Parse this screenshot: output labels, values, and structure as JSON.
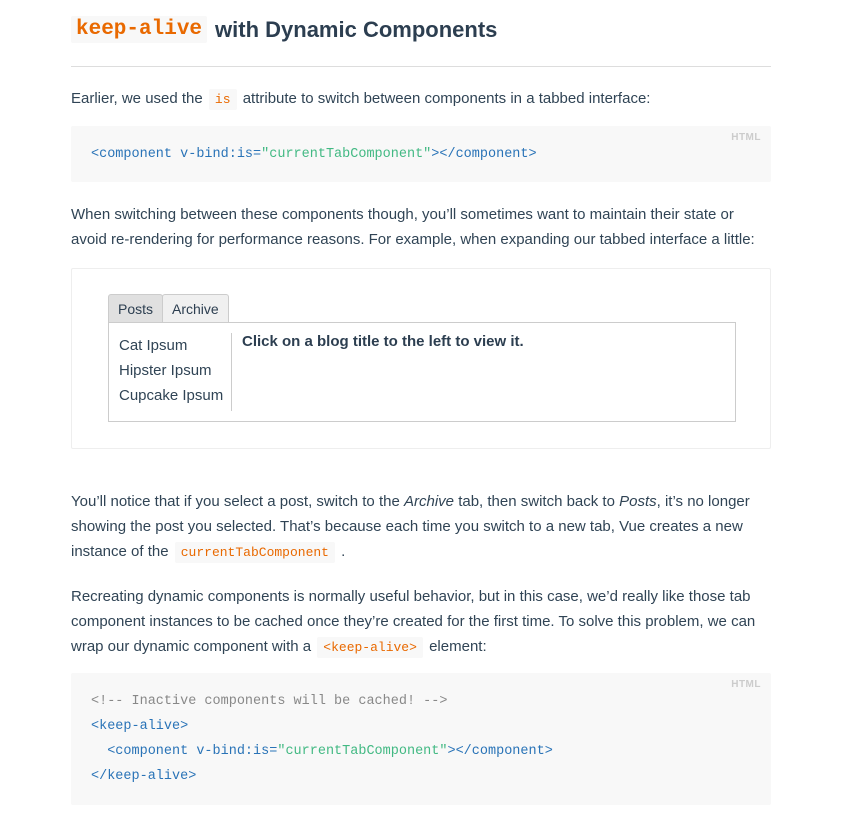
{
  "header": {
    "title_code": "keep-alive",
    "title_rest": "with Dynamic Components"
  },
  "intro": {
    "before": "Earlier, we used the",
    "code": "is",
    "after": "attribute to switch between components in a tabbed interface:"
  },
  "code1": {
    "lang": "HTML",
    "tag_open": "<component",
    "attr": " v-bind:is=",
    "value": "\"currentTabComponent\"",
    "tag_close": "></component>"
  },
  "para2": {
    "line1": "When switching between these components though, you’ll sometimes want to maintain their state or",
    "line2": "avoid re-rendering for performance reasons. For example, when expanding our tabbed interface a little:"
  },
  "demo": {
    "tabs": [
      {
        "label": "Posts",
        "active": true
      },
      {
        "label": "Archive",
        "active": false
      }
    ],
    "posts": [
      "Cat Ipsum",
      "Hipster Ipsum",
      "Cupcake Ipsum"
    ],
    "message": "Click on a blog title to the left to view it."
  },
  "para3": {
    "l1_a": "You’ll notice that if you select a post, switch to the",
    "l1_b": "Archive",
    "l1_c": "tab, then switch back to",
    "l1_d": "Posts",
    "l1_e": ", it’s no longer",
    "line2": "showing the post you selected. That’s because each time you switch to a new tab, Vue creates a new",
    "l3_a": "instance of the",
    "l3_code": "currentTabComponent",
    "l3_b": "."
  },
  "para4": {
    "line1": "Recreating dynamic components is normally useful behavior, but in this case, we’d really like those tab",
    "line2": "component instances to be cached once they’re created for the first time. To solve this problem, we can",
    "l3_a": "wrap our dynamic component with a",
    "l3_code": "<keep-alive>",
    "l3_b": "element:"
  },
  "code2": {
    "lang": "HTML",
    "comment": "<!-- Inactive components will be cached! -->",
    "open": "<keep-alive>",
    "inner_tag": "<component",
    "inner_attr": " v-bind:is=",
    "inner_value": "\"currentTabComponent\"",
    "inner_close": "></component>",
    "close": "</keep-alive>"
  }
}
